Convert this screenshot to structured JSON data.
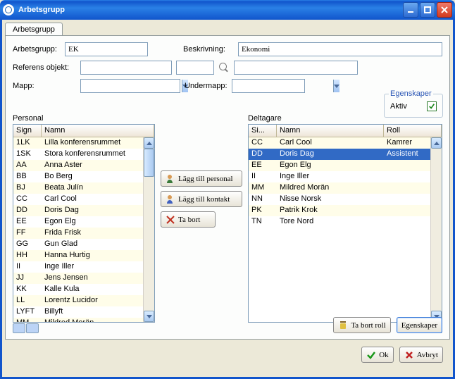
{
  "window": {
    "title": "Arbetsgrupp"
  },
  "tabs": [
    {
      "label": "Arbetsgrupp"
    }
  ],
  "form": {
    "arbetsgrupp_label": "Arbetsgrupp:",
    "arbetsgrupp_value": "EK",
    "beskrivning_label": "Beskrivning:",
    "beskrivning_value": "Ekonomi",
    "referens_label": "Referens objekt:",
    "mapp_label": "Mapp:",
    "undermapp_label": "Undermapp:"
  },
  "properties": {
    "legend": "Egenskaper",
    "aktiv_label": "Aktiv",
    "aktiv_checked": true
  },
  "personal": {
    "title": "Personal",
    "columns": {
      "sign": "Sign",
      "namn": "Namn"
    },
    "rows": [
      {
        "sign": "1LK",
        "namn": "Lilla konferensrummet"
      },
      {
        "sign": "1SK",
        "namn": "Stora konferensrummet"
      },
      {
        "sign": "AA",
        "namn": "Anna Aster"
      },
      {
        "sign": "BB",
        "namn": "Bo Berg"
      },
      {
        "sign": "BJ",
        "namn": "Beata Julín"
      },
      {
        "sign": "CC",
        "namn": "Carl Cool"
      },
      {
        "sign": "DD",
        "namn": "Doris Dag"
      },
      {
        "sign": "EE",
        "namn": "Egon Elg"
      },
      {
        "sign": "FF",
        "namn": "Frida Frisk"
      },
      {
        "sign": "GG",
        "namn": "Gun Glad"
      },
      {
        "sign": "HH",
        "namn": "Hanna Hurtig"
      },
      {
        "sign": "II",
        "namn": "Inge Iller"
      },
      {
        "sign": "JJ",
        "namn": "Jens Jensen"
      },
      {
        "sign": "KK",
        "namn": "Kalle Kula"
      },
      {
        "sign": "LL",
        "namn": "Lorentz Lucidor"
      },
      {
        "sign": "LYFT",
        "namn": "Billyft"
      },
      {
        "sign": "MM",
        "namn": "Mildred Morän"
      }
    ]
  },
  "midButtons": {
    "add_personal": "Lägg till personal",
    "add_kontakt": "Lägg till kontakt",
    "remove": "Ta bort"
  },
  "deltagare": {
    "title": "Deltagare",
    "columns": {
      "sign": "Si...",
      "namn": "Namn",
      "roll": "Roll"
    },
    "selectedIndex": 1,
    "rows": [
      {
        "sign": "CC",
        "namn": "Carl Cool",
        "roll": "Kamrer"
      },
      {
        "sign": "DD",
        "namn": "Doris Dag",
        "roll": "Assistent"
      },
      {
        "sign": "EE",
        "namn": "Egon Elg",
        "roll": ""
      },
      {
        "sign": "II",
        "namn": "Inge Iller",
        "roll": ""
      },
      {
        "sign": "MM",
        "namn": "Mildred Morän",
        "roll": ""
      },
      {
        "sign": "NN",
        "namn": "Nisse Norsk",
        "roll": ""
      },
      {
        "sign": "PK",
        "namn": "Patrik Krok",
        "roll": ""
      },
      {
        "sign": "TN",
        "namn": "Tore Nord",
        "roll": ""
      }
    ]
  },
  "bottom": {
    "ta_bort_roll": "Ta bort roll",
    "egenskaper": "Egenskaper"
  },
  "dialog": {
    "ok": "Ok",
    "avbryt": "Avbryt"
  }
}
